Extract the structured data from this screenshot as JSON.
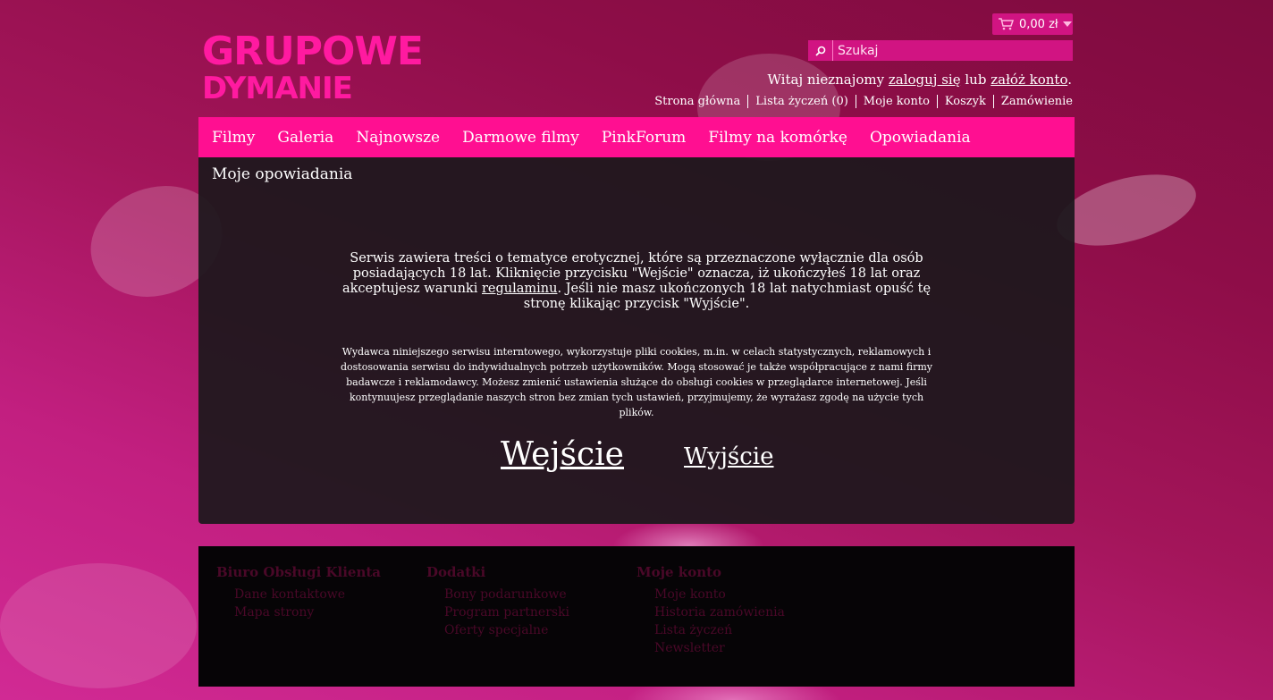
{
  "logo": {
    "line1": "GRUPOWE",
    "line2": "DYMANIE"
  },
  "cart": {
    "amount": "0,00 zł",
    "icon": "cart-icon"
  },
  "search": {
    "placeholder": "Szukaj",
    "icon": "search-icon"
  },
  "welcome": {
    "prefix": "Witaj nieznajomy ",
    "login": "zaloguj się",
    "middle": " lub ",
    "register": "załóż konto",
    "suffix": "."
  },
  "toplinks": [
    "Strona główna",
    "Lista życzeń (0)",
    "Moje konto",
    "Koszyk",
    "Zamówienie"
  ],
  "nav": [
    "Filmy",
    "Galeria",
    "Najnowsze",
    "Darmowe filmy",
    "PinkForum",
    "Filmy na komórkę",
    "Opowiadania"
  ],
  "content": {
    "title": "Moje opowiadania",
    "notice_before": "Serwis zawiera treści o tematyce erotycznej, które są przeznaczone wyłącznie dla osób posiadających 18 lat. Kliknięcie przycisku \"Wejście\" oznacza, iż ukończyłeś 18 lat oraz akceptujesz warunki ",
    "notice_link": "regulaminu",
    "notice_after": ". Jeśli nie masz ukończonych 18 lat natychmiast opuść tę stronę klikając przycisk \"Wyjście\".",
    "cookies": "Wydawca niniejszego serwisu interntowego, wykorzystuje pliki cookies, m.in. w celach statystycznych, reklamowych i dostosowania serwisu do indywidualnych potrzeb użytkowników. Mogą stosować je także współpracujące z nami firmy badawcze i reklamodawcy. Możesz zmienić ustawienia służące do obsługi cookies w przeglądarce internetowej. Jeśli kontynuujesz przeglądanie naszych stron bez zmian tych ustawień, przyjmujemy, że wyrażasz zgodę na użycie tych plików.",
    "enter": "Wejście",
    "exit": "Wyjście"
  },
  "footer": {
    "columns": [
      {
        "title": "Biuro Obsługi Klienta",
        "links": [
          "Dane kontaktowe",
          "Mapa strony"
        ]
      },
      {
        "title": "Dodatki",
        "links": [
          "Bony podarunkowe",
          "Program partnerski",
          "Oferty specjalne"
        ]
      },
      {
        "title": "Moje konto",
        "links": [
          "Moje konto",
          "Historia zamówienia",
          "Lista życzeń",
          "Newsletter"
        ]
      }
    ]
  },
  "colors": {
    "accent": "#ff0f91",
    "cart_bg": "#d11482",
    "footer_text": "#4a0828"
  }
}
